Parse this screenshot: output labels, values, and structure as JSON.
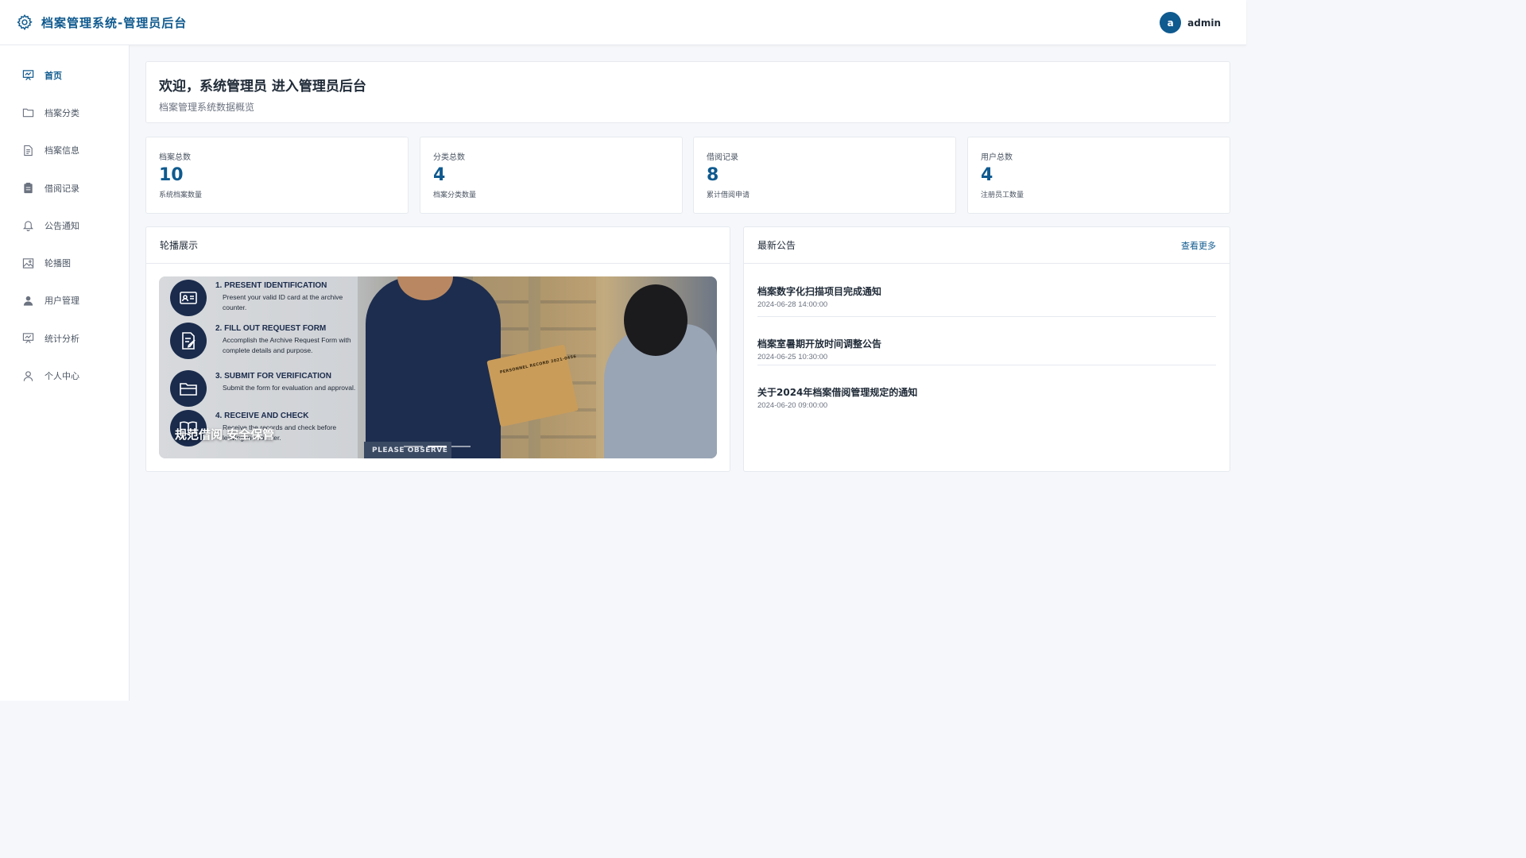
{
  "header": {
    "title": "档案管理系统-管理员后台",
    "user": {
      "avatar_letter": "a",
      "name": "admin"
    }
  },
  "sidebar": {
    "items": [
      {
        "label": "首页",
        "icon": "chart-board-icon",
        "active": true
      },
      {
        "label": "档案分类",
        "icon": "folder-icon"
      },
      {
        "label": "档案信息",
        "icon": "document-icon"
      },
      {
        "label": "借阅记录",
        "icon": "clipboard-icon"
      },
      {
        "label": "公告通知",
        "icon": "bell-icon"
      },
      {
        "label": "轮播图",
        "icon": "image-icon"
      },
      {
        "label": "用户管理",
        "icon": "user-filled-icon"
      },
      {
        "label": "统计分析",
        "icon": "chart-board-icon"
      },
      {
        "label": "个人中心",
        "icon": "user-outline-icon"
      }
    ]
  },
  "welcome": {
    "title": "欢迎，系统管理员 进入管理员后台",
    "subtitle": "档案管理系统数据概览"
  },
  "stats": [
    {
      "label": "档案总数",
      "value": "10",
      "desc": "系统档案数量"
    },
    {
      "label": "分类总数",
      "value": "4",
      "desc": "档案分类数量"
    },
    {
      "label": "借阅记录",
      "value": "8",
      "desc": "累计借阅申请"
    },
    {
      "label": "用户总数",
      "value": "4",
      "desc": "注册员工数量"
    }
  ],
  "carousel": {
    "title": "轮播展示",
    "caption": "规范借阅 安全保管",
    "steps": [
      {
        "title": "1. PRESENT IDENTIFICATION",
        "desc": "Present your valid ID card at the archive counter."
      },
      {
        "title": "2. FILL OUT REQUEST FORM",
        "desc": "Accomplish the Archive Request Form with complete details and purpose."
      },
      {
        "title": "3. SUBMIT FOR VERIFICATION",
        "desc": "Submit the form for evaluation and approval."
      },
      {
        "title": "4. RECEIVE AND CHECK",
        "desc": "Receive the records and check before leaving the counter."
      }
    ],
    "folder_label": "PERSONNEL RECORD 2021-0456",
    "sign_text": "PLEASE OBSERVE",
    "active_slide": 1,
    "slide_count": 3
  },
  "announcements": {
    "title": "最新公告",
    "more_label": "查看更多",
    "items": [
      {
        "title": "档案数字化扫描项目完成通知",
        "time": "2024-06-28 14:00:00"
      },
      {
        "title": "档案室暑期开放时间调整公告",
        "time": "2024-06-25 10:30:00"
      },
      {
        "title": "关于2024年档案借阅管理规定的通知",
        "time": "2024-06-20 09:00:00"
      }
    ]
  },
  "colors": {
    "primary": "#0f5a8f",
    "text": "#1f2a37",
    "muted": "#6b7280",
    "border": "#e6e9ef",
    "background": "#f5f7fa"
  }
}
